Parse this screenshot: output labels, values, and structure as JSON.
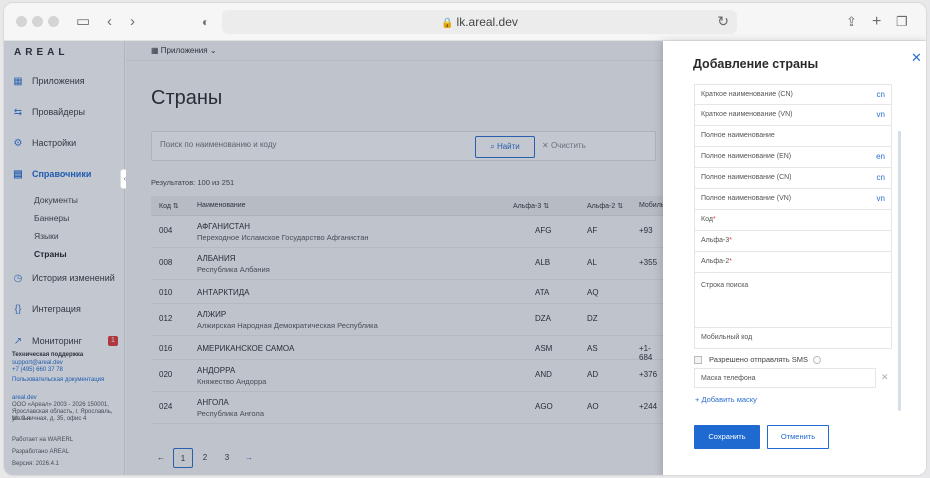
{
  "browser": {
    "url": "lk.areal.dev"
  },
  "sidebar": {
    "logo": "AREAL",
    "items": [
      {
        "label": "Приложения",
        "icon": "grid-icon"
      },
      {
        "label": "Провайдеры",
        "icon": "provider-icon"
      },
      {
        "label": "Настройки",
        "icon": "gear-icon"
      },
      {
        "label": "Справочники",
        "icon": "reference-icon"
      },
      {
        "label": "История изменений",
        "icon": "history-icon"
      },
      {
        "label": "Интеграция",
        "icon": "braces-icon"
      },
      {
        "label": "Мониторинг",
        "icon": "chart-icon"
      }
    ],
    "subitems": [
      "Документы",
      "Баннеры",
      "Языки",
      "Страны"
    ],
    "monitoring_badge": "1",
    "support": {
      "title": "Техническая поддержка",
      "email": "support@areal.dev",
      "phone": "+7 (495) 660 37 78",
      "docs": "Пользовательская документация"
    },
    "company": {
      "site": "areal.dev",
      "line1": "ООО «Ареал» 2003 - 2026 150001,",
      "line2": "Ярославская область, г. Ярославль, ул. 2-я",
      "line3": "Мельничная, д. 35, офис 4",
      "works_on": "Работает на WARERL",
      "developed": "Разработано AREAL",
      "version": "Версия: 2026.4.1"
    }
  },
  "main": {
    "topbar_label": "Приложения",
    "title": "Страны",
    "search_placeholder": "Поиск по наименованию и коду",
    "find_label": "Найти",
    "clear_label": "Очистить",
    "results": "Результатов: 100 из 251",
    "columns": [
      "Код",
      "Наименование",
      "Альфа-3",
      "Альфа-2",
      "Мобильн"
    ],
    "rows": [
      {
        "code": "004",
        "name": "АФГАНИСТАН",
        "full": "Переходное Исламское Государство Афганистан",
        "a3": "AFG",
        "a2": "AF",
        "mob": "+93"
      },
      {
        "code": "008",
        "name": "АЛБАНИЯ",
        "full": "Республика Албания",
        "a3": "ALB",
        "a2": "AL",
        "mob": "+355"
      },
      {
        "code": "010",
        "name": "АНТАРКТИДА",
        "full": "",
        "a3": "ATA",
        "a2": "AQ",
        "mob": ""
      },
      {
        "code": "012",
        "name": "АЛЖИР",
        "full": "Алжирская Народная Демократическая Республика",
        "a3": "DZA",
        "a2": "DZ",
        "mob": ""
      },
      {
        "code": "016",
        "name": "АМЕРИКАНСКОЕ САМОА",
        "full": "",
        "a3": "ASM",
        "a2": "AS",
        "mob": "+1-684"
      },
      {
        "code": "020",
        "name": "АНДОРРА",
        "full": "Княжество Андорра",
        "a3": "AND",
        "a2": "AD",
        "mob": "+376"
      },
      {
        "code": "024",
        "name": "АНГОЛА",
        "full": "Республика Ангола",
        "a3": "AGO",
        "a2": "AO",
        "mob": "+244"
      }
    ],
    "pages": [
      "1",
      "2",
      "3"
    ]
  },
  "drawer": {
    "title": "Добавление страны",
    "fields": [
      {
        "label": "Краткое наименование (CN)",
        "lang": "cn"
      },
      {
        "label": "Краткое наименование (VN)",
        "lang": "vn"
      },
      {
        "label": "Полное наименование",
        "lang": ""
      },
      {
        "label": "Полное наименование (EN)",
        "lang": "en"
      },
      {
        "label": "Полное наименование (CN)",
        "lang": "cn"
      },
      {
        "label": "Полное наименование (VN)",
        "lang": "vn"
      }
    ],
    "code_label": "Код",
    "alpha3_label": "Альфа-3",
    "alpha2_label": "Альфа-2",
    "search_string_label": "Строка поиска",
    "mobile_code_label": "Мобильный код",
    "sms_label": "Разрешено отправлять SMS",
    "phone_mask_label": "Маска телефона",
    "add_mask_label": "Добавить маску",
    "save_label": "Сохранить",
    "cancel_label": "Отменить"
  }
}
